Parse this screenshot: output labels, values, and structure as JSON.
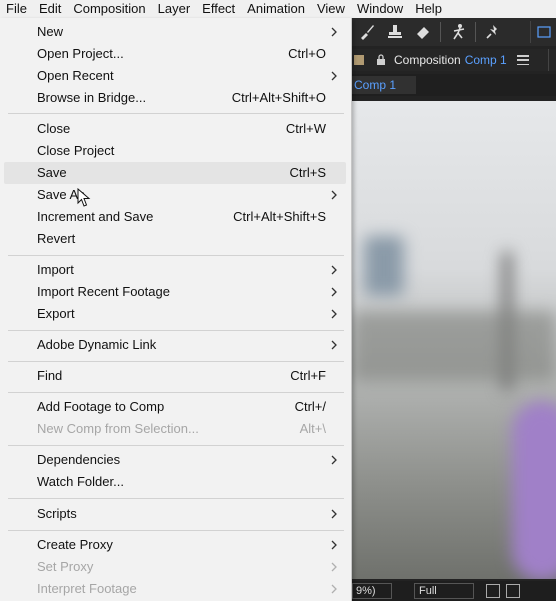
{
  "menubar": {
    "items": [
      "File",
      "Edit",
      "Composition",
      "Layer",
      "Effect",
      "Animation",
      "View",
      "Window",
      "Help"
    ]
  },
  "file_menu": {
    "items": [
      {
        "label": "New",
        "shortcut": "",
        "submenu": true,
        "disabled": false
      },
      {
        "label": "Open Project...",
        "shortcut": "Ctrl+O",
        "submenu": false,
        "disabled": false
      },
      {
        "label": "Open Recent",
        "shortcut": "",
        "submenu": true,
        "disabled": false
      },
      {
        "label": "Browse in Bridge...",
        "shortcut": "Ctrl+Alt+Shift+O",
        "submenu": false,
        "disabled": false
      },
      {
        "label": "Close",
        "shortcut": "Ctrl+W",
        "submenu": false,
        "disabled": false
      },
      {
        "label": "Close Project",
        "shortcut": "",
        "submenu": false,
        "disabled": false
      },
      {
        "label": "Save",
        "shortcut": "Ctrl+S",
        "submenu": false,
        "disabled": false,
        "highlighted": true
      },
      {
        "label": "Save As",
        "shortcut": "",
        "submenu": true,
        "disabled": false
      },
      {
        "label": "Increment and Save",
        "shortcut": "Ctrl+Alt+Shift+S",
        "submenu": false,
        "disabled": false
      },
      {
        "label": "Revert",
        "shortcut": "",
        "submenu": false,
        "disabled": false
      },
      {
        "label": "Import",
        "shortcut": "",
        "submenu": true,
        "disabled": false
      },
      {
        "label": "Import Recent Footage",
        "shortcut": "",
        "submenu": true,
        "disabled": false
      },
      {
        "label": "Export",
        "shortcut": "",
        "submenu": true,
        "disabled": false
      },
      {
        "label": "Adobe Dynamic Link",
        "shortcut": "",
        "submenu": true,
        "disabled": false
      },
      {
        "label": "Find",
        "shortcut": "Ctrl+F",
        "submenu": false,
        "disabled": false
      },
      {
        "label": "Add Footage to Comp",
        "shortcut": "Ctrl+/",
        "submenu": false,
        "disabled": false
      },
      {
        "label": "New Comp from Selection...",
        "shortcut": "Alt+\\",
        "submenu": false,
        "disabled": true
      },
      {
        "label": "Dependencies",
        "shortcut": "",
        "submenu": true,
        "disabled": false
      },
      {
        "label": "Watch Folder...",
        "shortcut": "",
        "submenu": false,
        "disabled": false
      },
      {
        "label": "Scripts",
        "shortcut": "",
        "submenu": true,
        "disabled": false
      },
      {
        "label": "Create Proxy",
        "shortcut": "",
        "submenu": true,
        "disabled": false
      },
      {
        "label": "Set Proxy",
        "shortcut": "",
        "submenu": true,
        "disabled": true
      },
      {
        "label": "Interpret Footage",
        "shortcut": "",
        "submenu": true,
        "disabled": true
      }
    ]
  },
  "composition_panel": {
    "title": "Composition",
    "comp_name": "Comp 1",
    "tab_label": "Comp 1"
  },
  "viewer_footer": {
    "zoom": "9%)",
    "resolution": "Full"
  },
  "colors": {
    "menu_bg": "#f2f2f2",
    "accent_blue": "#5aa0ff",
    "disabled_text": "#a6a6a6"
  }
}
